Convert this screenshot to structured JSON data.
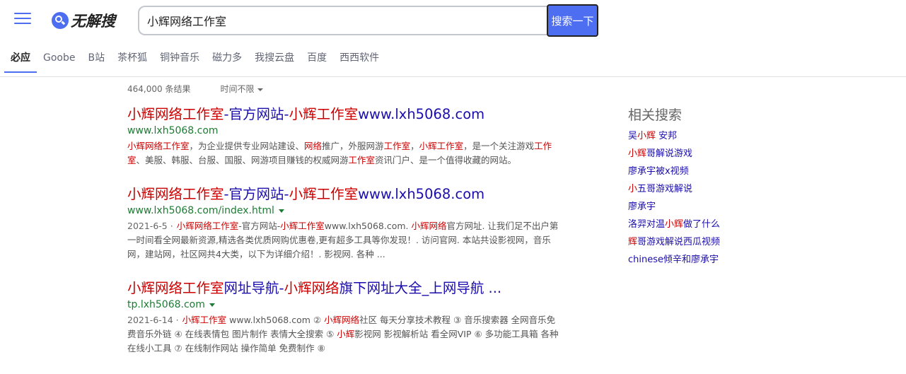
{
  "header": {
    "logo_text": "无解搜",
    "search_value": "小辉网络工作室",
    "search_button": "搜索一下"
  },
  "tabs": [
    "必应",
    "Goobe",
    "B站",
    "茶杯狐",
    "铜钟音乐",
    "磁力多",
    "我搜云盘",
    "百度",
    "西西软件"
  ],
  "stats": {
    "count": "464,000 条结果",
    "time_filter": "时间不限"
  },
  "results": [
    {
      "title_parts": [
        {
          "t": "小辉网络工作室",
          "hl": true
        },
        {
          "t": "-官方网站-",
          "hl": false
        },
        {
          "t": "小辉工作室",
          "hl": true
        },
        {
          "t": "www.lxh5068.com",
          "hl": false
        }
      ],
      "url": "www.lxh5068.com",
      "url_caret": false,
      "date": "",
      "abstract_parts": [
        {
          "t": "小辉网络工作室",
          "hl": true
        },
        {
          "t": "，为企业提供专业网站建设、",
          "hl": false
        },
        {
          "t": "网络",
          "hl": true
        },
        {
          "t": "推广，外服网游",
          "hl": false
        },
        {
          "t": "工作室",
          "hl": true
        },
        {
          "t": "，",
          "hl": false
        },
        {
          "t": "小辉工作室",
          "hl": true
        },
        {
          "t": "，是一个关注游戏",
          "hl": false
        },
        {
          "t": "工作室",
          "hl": true
        },
        {
          "t": "、美服、韩服、台服、国服、网游项目赚钱的权威网游",
          "hl": false
        },
        {
          "t": "工作室",
          "hl": true
        },
        {
          "t": "资讯门户、是一个值得收藏的网站。",
          "hl": false
        }
      ]
    },
    {
      "title_parts": [
        {
          "t": "小辉网络工作室",
          "hl": true
        },
        {
          "t": "-官方网站-",
          "hl": false
        },
        {
          "t": "小辉工作室",
          "hl": true
        },
        {
          "t": "www.lxh5068.com",
          "hl": false
        }
      ],
      "url": "www.lxh5068.com/index.html",
      "url_caret": true,
      "date": "2021-6-5 ·",
      "abstract_parts": [
        {
          "t": "小辉网络工作室",
          "hl": true
        },
        {
          "t": "-官方网站-",
          "hl": false
        },
        {
          "t": "小辉工作室",
          "hl": true
        },
        {
          "t": "www.lxh5068.com. ",
          "hl": false
        },
        {
          "t": "小辉网络",
          "hl": true
        },
        {
          "t": "官方网址. 让我们足不出户第一时间看全网最新资源,精选各类优质网购优惠卷,更有超多工具等你发现！. 访问官网. 本站共设影视网，音乐网，建站网，社区网共4大类，以下为详细介绍！. 影视网. 各种 ...",
          "hl": false
        }
      ]
    },
    {
      "title_parts": [
        {
          "t": "小辉网络工作室",
          "hl": true
        },
        {
          "t": "网址导航-",
          "hl": false
        },
        {
          "t": "小辉网络",
          "hl": true
        },
        {
          "t": "旗下网址大全_上网导航 ...",
          "hl": false
        }
      ],
      "url": "tp.lxh5068.com",
      "url_caret": true,
      "date": "2021-6-14 ·",
      "abstract_parts": [
        {
          "t": "小辉工作室",
          "hl": true
        },
        {
          "t": " www.lxh5068.com ② ",
          "hl": false
        },
        {
          "t": "小辉网络",
          "hl": true
        },
        {
          "t": "社区 每天分享技术教程 ③ 音乐搜索器 全网音乐免费音乐外链 ④ 在线表情包 图片制作 表情大全搜索 ⑤ ",
          "hl": false
        },
        {
          "t": "小辉",
          "hl": true
        },
        {
          "t": "影视网 影视解析站 看全网VIP ⑥ 多功能工具箱 各种在线小工具 ⑦ 在线制作网站 操作简单 免费制作 ⑧",
          "hl": false
        }
      ]
    }
  ],
  "related": {
    "title": "相关搜索",
    "items": [
      [
        {
          "t": "吴",
          "hl": false
        },
        {
          "t": "小辉",
          "hl": true
        },
        {
          "t": " 安邦",
          "hl": false
        }
      ],
      [
        {
          "t": "小辉",
          "hl": true
        },
        {
          "t": "哥解说游戏",
          "hl": false
        }
      ],
      [
        {
          "t": "廖承宇被x视频",
          "hl": false
        }
      ],
      [
        {
          "t": "小",
          "hl": true
        },
        {
          "t": "五哥游戏解说",
          "hl": false
        }
      ],
      [
        {
          "t": "廖承宇",
          "hl": false
        }
      ],
      [
        {
          "t": "洛羿对温",
          "hl": false
        },
        {
          "t": "小辉",
          "hl": true
        },
        {
          "t": "做了什么",
          "hl": false
        }
      ],
      [
        {
          "t": "辉",
          "hl": true
        },
        {
          "t": "哥游戏解说西瓜视频",
          "hl": false
        }
      ],
      [
        {
          "t": "chinese倾辛和廖承宇",
          "hl": false
        }
      ]
    ]
  }
}
